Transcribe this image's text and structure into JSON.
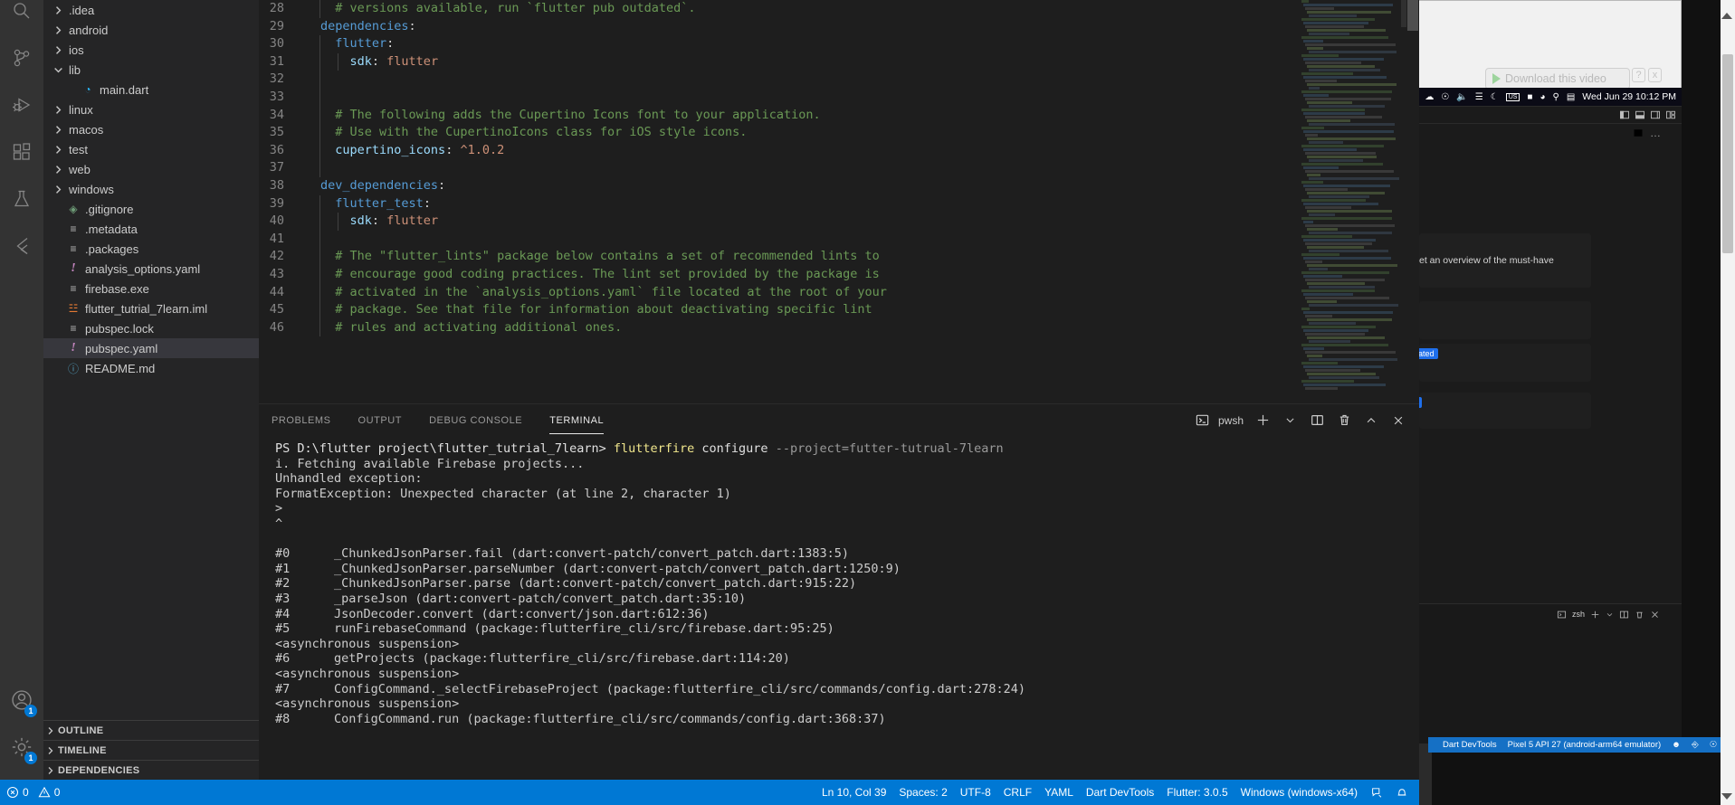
{
  "app": {
    "name": "Visual Studio Code"
  },
  "activity_bar": {
    "icons": [
      {
        "name": "search-icon",
        "badge": null
      },
      {
        "name": "source-control-icon",
        "badge": null
      },
      {
        "name": "run-and-debug-icon",
        "badge": null
      },
      {
        "name": "extensions-icon",
        "badge": null
      },
      {
        "name": "testing-icon",
        "badge": null
      },
      {
        "name": "flutter-icon",
        "badge": null
      }
    ],
    "bottom_icons": [
      {
        "name": "accounts-icon",
        "badge": "1"
      },
      {
        "name": "manage-settings-icon",
        "badge": "1"
      }
    ]
  },
  "explorer": {
    "items": [
      {
        "label": ".idea",
        "type": "folder",
        "expanded": false,
        "indent": 0,
        "icon": "chevron-right-icon"
      },
      {
        "label": "android",
        "type": "folder",
        "expanded": false,
        "indent": 0,
        "icon": "chevron-right-icon"
      },
      {
        "label": "ios",
        "type": "folder",
        "expanded": false,
        "indent": 0,
        "icon": "chevron-right-icon"
      },
      {
        "label": "lib",
        "type": "folder",
        "expanded": true,
        "indent": 0,
        "icon": "chevron-down-icon"
      },
      {
        "label": "main.dart",
        "type": "file",
        "indent": 1,
        "icon": "dart-file-icon"
      },
      {
        "label": "linux",
        "type": "folder",
        "expanded": false,
        "indent": 0,
        "icon": "chevron-right-icon"
      },
      {
        "label": "macos",
        "type": "folder",
        "expanded": false,
        "indent": 0,
        "icon": "chevron-right-icon"
      },
      {
        "label": "test",
        "type": "folder",
        "expanded": false,
        "indent": 0,
        "icon": "chevron-right-icon"
      },
      {
        "label": "web",
        "type": "folder",
        "expanded": false,
        "indent": 0,
        "icon": "chevron-right-icon"
      },
      {
        "label": "windows",
        "type": "folder",
        "expanded": false,
        "indent": 0,
        "icon": "chevron-right-icon"
      },
      {
        "label": ".gitignore",
        "type": "file",
        "indent": 0,
        "icon": "git-file-icon"
      },
      {
        "label": ".metadata",
        "type": "file",
        "indent": 0,
        "icon": "text-file-icon"
      },
      {
        "label": ".packages",
        "type": "file",
        "indent": 0,
        "icon": "text-file-icon"
      },
      {
        "label": "analysis_options.yaml",
        "type": "file",
        "indent": 0,
        "icon": "yaml-file-icon"
      },
      {
        "label": "firebase.exe",
        "type": "file",
        "indent": 0,
        "icon": "text-file-icon"
      },
      {
        "label": "flutter_tutrial_7learn.iml",
        "type": "file",
        "indent": 0,
        "icon": "iml-file-icon"
      },
      {
        "label": "pubspec.lock",
        "type": "file",
        "indent": 0,
        "icon": "text-file-icon"
      },
      {
        "label": "pubspec.yaml",
        "type": "file",
        "indent": 0,
        "icon": "yaml-file-icon",
        "selected": true
      },
      {
        "label": "README.md",
        "type": "file",
        "indent": 0,
        "icon": "markdown-file-icon"
      }
    ],
    "panels": [
      {
        "label": "OUTLINE"
      },
      {
        "label": "TIMELINE"
      },
      {
        "label": "DEPENDENCIES"
      }
    ]
  },
  "editor": {
    "language": "YAML",
    "first_visible_line": 28,
    "lines": [
      {
        "n": "28",
        "segments": [
          {
            "t": "  # versions available, run `flutter pub outdated`.",
            "c": "k-com"
          }
        ]
      },
      {
        "n": "29",
        "segments": [
          {
            "t": "dependencies",
            "c": "k-key"
          },
          {
            "t": ":",
            "c": "k-pun"
          }
        ]
      },
      {
        "n": "30",
        "segments": [
          {
            "t": "  "
          },
          {
            "t": "flutter",
            "c": "k-key"
          },
          {
            "t": ":",
            "c": "k-pun"
          }
        ]
      },
      {
        "n": "31",
        "segments": [
          {
            "t": "    "
          },
          {
            "t": "sdk",
            "c": "k-key2"
          },
          {
            "t": ": ",
            "c": "k-pun"
          },
          {
            "t": "flutter",
            "c": "k-str"
          }
        ]
      },
      {
        "n": "32",
        "segments": [
          {
            "t": ""
          }
        ]
      },
      {
        "n": "33",
        "segments": [
          {
            "t": ""
          }
        ]
      },
      {
        "n": "34",
        "segments": [
          {
            "t": "  # The following adds the Cupertino Icons font to your application.",
            "c": "k-com"
          }
        ]
      },
      {
        "n": "35",
        "segments": [
          {
            "t": "  # Use with the CupertinoIcons class for iOS style icons.",
            "c": "k-com"
          }
        ]
      },
      {
        "n": "36",
        "segments": [
          {
            "t": "  "
          },
          {
            "t": "cupertino_icons",
            "c": "k-key2"
          },
          {
            "t": ": ",
            "c": "k-pun"
          },
          {
            "t": "^1.0.2",
            "c": "k-str"
          }
        ]
      },
      {
        "n": "37",
        "segments": [
          {
            "t": ""
          }
        ]
      },
      {
        "n": "38",
        "segments": [
          {
            "t": "dev_dependencies",
            "c": "k-key"
          },
          {
            "t": ":",
            "c": "k-pun"
          }
        ]
      },
      {
        "n": "39",
        "segments": [
          {
            "t": "  "
          },
          {
            "t": "flutter_test",
            "c": "k-key"
          },
          {
            "t": ":",
            "c": "k-pun"
          }
        ]
      },
      {
        "n": "40",
        "segments": [
          {
            "t": "    "
          },
          {
            "t": "sdk",
            "c": "k-key2"
          },
          {
            "t": ": ",
            "c": "k-pun"
          },
          {
            "t": "flutter",
            "c": "k-str"
          }
        ]
      },
      {
        "n": "41",
        "segments": [
          {
            "t": ""
          }
        ]
      },
      {
        "n": "42",
        "segments": [
          {
            "t": "  # The \"flutter_lints\" package below contains a set of recommended lints to",
            "c": "k-com"
          }
        ]
      },
      {
        "n": "43",
        "segments": [
          {
            "t": "  # encourage good coding practices. The lint set provided by the package is",
            "c": "k-com"
          }
        ]
      },
      {
        "n": "44",
        "segments": [
          {
            "t": "  # activated in the `analysis_options.yaml` file located at the root of your",
            "c": "k-com"
          }
        ]
      },
      {
        "n": "45",
        "segments": [
          {
            "t": "  # package. See that file for information about deactivating specific lint",
            "c": "k-com"
          }
        ]
      },
      {
        "n": "46",
        "segments": [
          {
            "t": "  # rules and activating additional ones.",
            "c": "k-com"
          }
        ]
      }
    ]
  },
  "panel": {
    "tabs": [
      {
        "label": "PROBLEMS",
        "active": false
      },
      {
        "label": "OUTPUT",
        "active": false
      },
      {
        "label": "DEBUG CONSOLE",
        "active": false
      },
      {
        "label": "TERMINAL",
        "active": true
      }
    ],
    "shell": "pwsh",
    "actions": [
      {
        "name": "new-terminal-icon",
        "label": "+"
      },
      {
        "name": "chevron-down-icon",
        "label": "v"
      },
      {
        "name": "split-terminal-icon",
        "label": "split"
      },
      {
        "name": "kill-terminal-icon",
        "label": "trash"
      },
      {
        "name": "maximize-panel-icon",
        "label": "chevron-up"
      },
      {
        "name": "close-panel-icon",
        "label": "x"
      }
    ],
    "terminal_lines": [
      {
        "segments": [
          {
            "t": "PS D:\\flutter project\\flutter_tutrial_7learn> ",
            "c": "t-wht"
          },
          {
            "t": "flutterfire",
            "c": "t-yel"
          },
          {
            "t": " configure ",
            "c": "t-wht"
          },
          {
            "t": "--project=futter-tutrual-7learn",
            "c": "t-dim"
          }
        ]
      },
      {
        "segments": [
          {
            "t": "i. Fetching available Firebase projects..."
          }
        ]
      },
      {
        "segments": [
          {
            "t": "Unhandled exception:"
          }
        ]
      },
      {
        "segments": [
          {
            "t": "FormatException: Unexpected character (at line 2, character 1)"
          }
        ]
      },
      {
        "segments": [
          {
            "t": ">"
          }
        ]
      },
      {
        "segments": [
          {
            "t": "^"
          }
        ]
      },
      {
        "segments": [
          {
            "t": ""
          }
        ]
      },
      {
        "segments": [
          {
            "t": "#0      _ChunkedJsonParser.fail (dart:convert-patch/convert_patch.dart:1383:5)"
          }
        ]
      },
      {
        "segments": [
          {
            "t": "#1      _ChunkedJsonParser.parseNumber (dart:convert-patch/convert_patch.dart:1250:9)"
          }
        ]
      },
      {
        "segments": [
          {
            "t": "#2      _ChunkedJsonParser.parse (dart:convert-patch/convert_patch.dart:915:22)"
          }
        ]
      },
      {
        "segments": [
          {
            "t": "#3      _parseJson (dart:convert-patch/convert_patch.dart:35:10)"
          }
        ]
      },
      {
        "segments": [
          {
            "t": "#4      JsonDecoder.convert (dart:convert/json.dart:612:36)"
          }
        ]
      },
      {
        "segments": [
          {
            "t": "#5      runFirebaseCommand (package:flutterfire_cli/src/firebase.dart:95:25)"
          }
        ]
      },
      {
        "segments": [
          {
            "t": "<asynchronous suspension>"
          }
        ]
      },
      {
        "segments": [
          {
            "t": "#6      getProjects (package:flutterfire_cli/src/firebase.dart:114:20)"
          }
        ]
      },
      {
        "segments": [
          {
            "t": "<asynchronous suspension>"
          }
        ]
      },
      {
        "segments": [
          {
            "t": "#7      ConfigCommand._selectFirebaseProject (package:flutterfire_cli/src/commands/config.dart:278:24)"
          }
        ]
      },
      {
        "segments": [
          {
            "t": "<asynchronous suspension>"
          }
        ]
      },
      {
        "segments": [
          {
            "t": "#8      ConfigCommand.run (package:flutterfire_cli/src/commands/config.dart:368:37)"
          }
        ]
      }
    ]
  },
  "status_bar": {
    "errors": "0",
    "warnings": "0",
    "right_items": [
      {
        "label": "Ln 10, Col 39",
        "name": "cursor-position"
      },
      {
        "label": "Spaces: 2",
        "name": "indentation"
      },
      {
        "label": "UTF-8",
        "name": "encoding"
      },
      {
        "label": "CRLF",
        "name": "eol"
      },
      {
        "label": "YAML",
        "name": "language-mode"
      },
      {
        "label": "Dart DevTools",
        "name": "dart-devtools"
      },
      {
        "label": "Flutter: 3.0.5",
        "name": "flutter-version"
      },
      {
        "label": "Windows (windows-x64)",
        "name": "target-device"
      }
    ],
    "icons": [
      {
        "name": "remote-feedback-icon"
      },
      {
        "name": "bell-icon"
      }
    ],
    "accent": "#0078d4"
  },
  "right_stack": {
    "browser_overlay": {
      "download_label": "Download this video",
      "help_label": "?",
      "close_label": "x"
    },
    "mac_menubar": {
      "time": "Wed Jun 29  10:12 PM",
      "input_source": "US",
      "icons": [
        "dropbox-icon",
        "cloud-sync-icon",
        "volume-icon",
        "bluetooth-icon",
        "do-not-disturb-icon",
        "keyboard-layout-icon",
        "battery-icon",
        "wifi-icon",
        "spotlight-search-icon",
        "control-center-icon"
      ]
    },
    "editor_caption": "et an overview of the must-have",
    "chips": [
      "dated",
      "d"
    ],
    "terminal_shell": "zsh",
    "status_bar": {
      "dart_devtools": "Dart DevTools",
      "device": "Pixel 5 API 27 (android-arm64 emulator)",
      "accent": "#1570c5"
    }
  }
}
